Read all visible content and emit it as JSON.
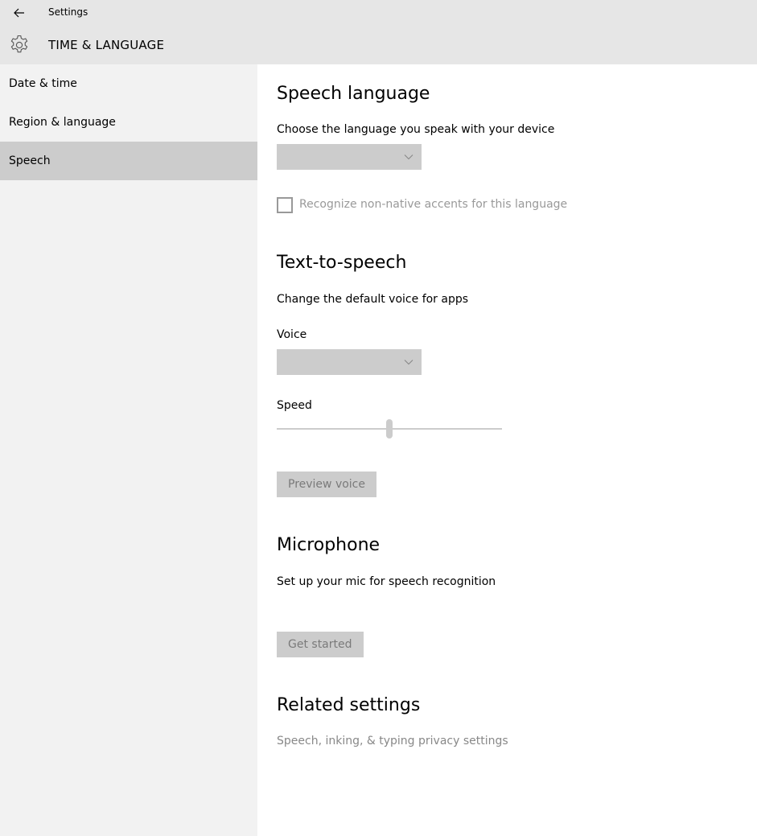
{
  "window": {
    "app_title": "Settings",
    "back_icon": "back-arrow-icon"
  },
  "header": {
    "icon": "gear-icon",
    "title": "TIME & LANGUAGE"
  },
  "sidebar": {
    "items": [
      {
        "label": "Date & time",
        "selected": false
      },
      {
        "label": "Region & language",
        "selected": false
      },
      {
        "label": "Speech",
        "selected": true
      }
    ],
    "selected_bg": "#cccccc"
  },
  "speech_language": {
    "heading": "Speech language",
    "description": "Choose the language you speak with your device",
    "dropdown_value": "",
    "accents_checkbox": {
      "label": "Recognize non-native accents for this language",
      "checked": false
    }
  },
  "text_to_speech": {
    "heading": "Text-to-speech",
    "description": "Change the default voice for apps",
    "voice_label": "Voice",
    "voice_value": "",
    "speed_label": "Speed",
    "speed_fraction": 0.5,
    "preview_button": "Preview voice"
  },
  "microphone": {
    "heading": "Microphone",
    "description": "Set up your mic for speech recognition",
    "get_started_button": "Get started"
  },
  "related_settings": {
    "heading": "Related settings",
    "link": "Speech, inking, & typing privacy settings"
  },
  "colors": {
    "chrome_bg": "#e6e6e6",
    "sidebar_bg": "#f2f2f2",
    "disabled_control": "#cccccc",
    "disabled_text": "#999999"
  }
}
